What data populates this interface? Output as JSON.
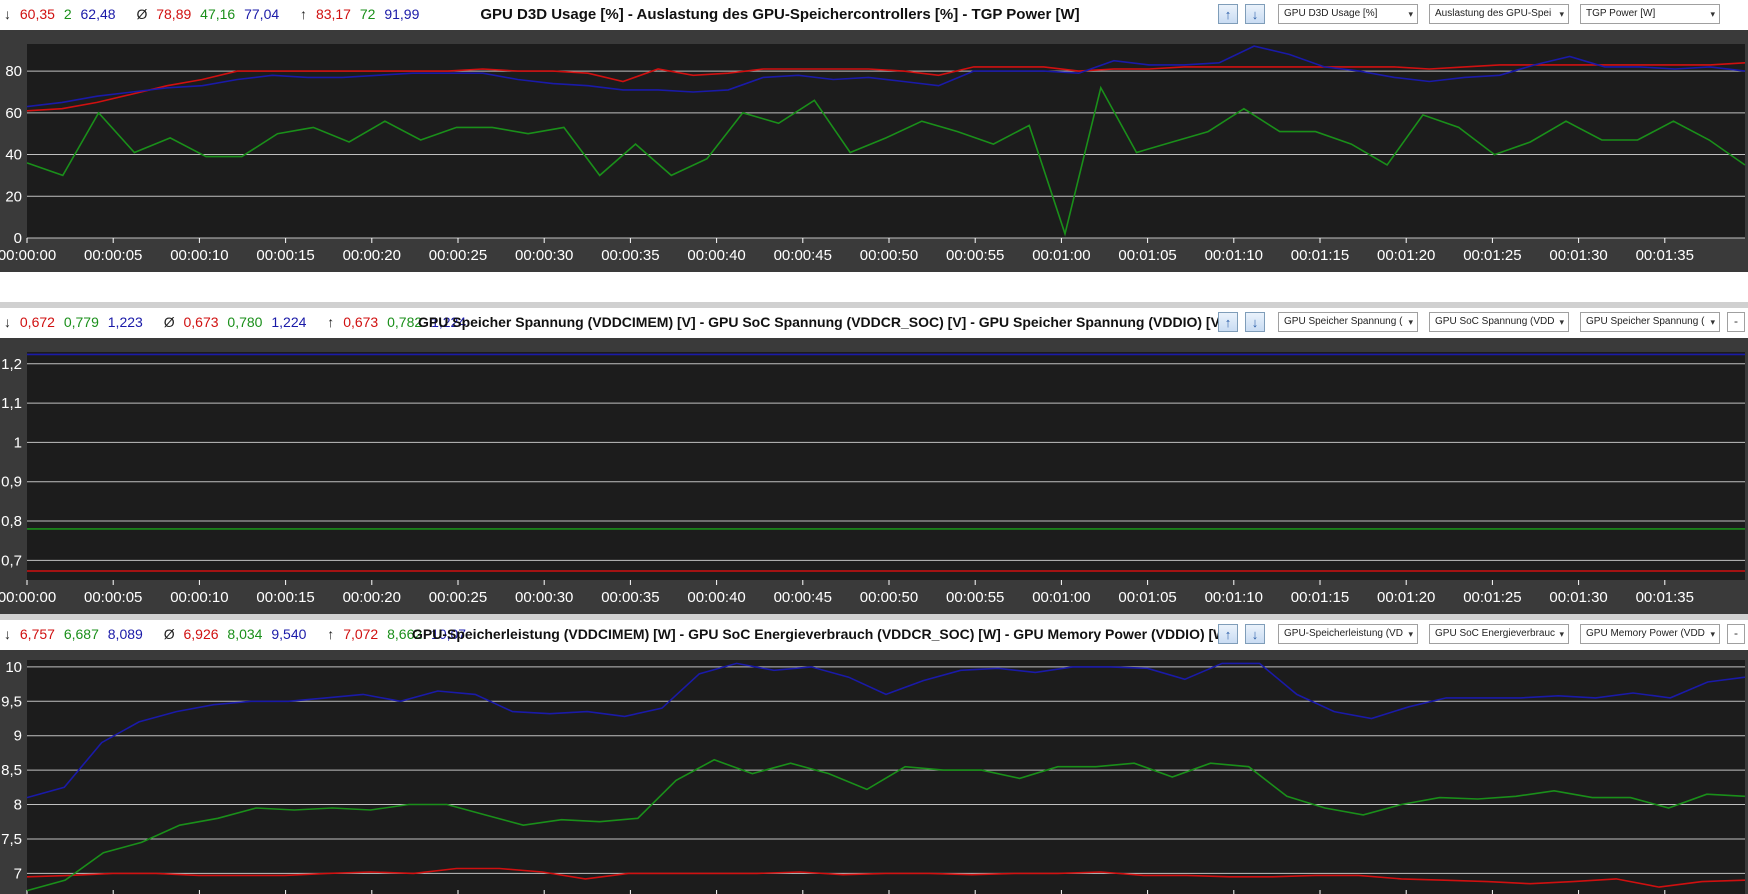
{
  "colors": {
    "red": "#d01010",
    "green": "#1a8f1a",
    "blue": "#1a1aa8",
    "bg": "#1c1c1c",
    "frame": "#3a3a3a",
    "grid": "#c0c0c0"
  },
  "panels": [
    {
      "title": "GPU D3D Usage [%]  -  Auslastung des GPU-Speichercontrollers [%]  -  TGP Power [W]",
      "stats": {
        "min": {
          "symbol": "↓",
          "values": [
            "60,35",
            "2",
            "62,48"
          ]
        },
        "avg": {
          "symbol": "Ø",
          "values": [
            "78,89",
            "47,16",
            "77,04"
          ]
        },
        "max": {
          "symbol": "↑",
          "values": [
            "83,17",
            "72",
            "91,99"
          ]
        }
      },
      "dropdowns": [
        "GPU D3D Usage [%]",
        "Auslastung des GPU-Spei",
        "TGP Power [W]"
      ],
      "has_minus_button": false
    },
    {
      "title": "GPU Speicher Spannung (VDDCIMEM) [V]  -  GPU SoC Spannung (VDDCR_SOC) [V]  -  GPU Speicher Spannung (VDDIO) [V]",
      "stats": {
        "min": {
          "symbol": "↓",
          "values": [
            "0,672",
            "0,779",
            "1,223"
          ]
        },
        "avg": {
          "symbol": "Ø",
          "values": [
            "0,673",
            "0,780",
            "1,224"
          ]
        },
        "max": {
          "symbol": "↑",
          "values": [
            "0,673",
            "0,782",
            "1,224"
          ]
        }
      },
      "dropdowns": [
        "GPU Speicher Spannung (",
        "GPU SoC Spannung (VDD",
        "GPU Speicher Spannung ("
      ],
      "has_minus_button": true
    },
    {
      "title": "GPU-Speicherleistung (VDDCIMEM) [W]  -  GPU SoC Energieverbrauch (VDDCR_SOC) [W]  -  GPU Memory Power (VDDIO) [W]",
      "stats": {
        "min": {
          "symbol": "↓",
          "values": [
            "6,757",
            "6,687",
            "8,089"
          ]
        },
        "avg": {
          "symbol": "Ø",
          "values": [
            "6,926",
            "8,034",
            "9,540"
          ]
        },
        "max": {
          "symbol": "↑",
          "values": [
            "7,072",
            "8,662",
            "10,07"
          ]
        }
      },
      "dropdowns": [
        "GPU-Speicherleistung (VD",
        "GPU SoC Energieverbrauc",
        "GPU Memory Power (VDD"
      ],
      "has_minus_button": true
    }
  ],
  "chart_data": [
    {
      "type": "line",
      "title": "GPU D3D Usage [%]  -  Auslastung des GPU-Speichercontrollers [%]  -  TGP Power [W]",
      "x_tick_labels": [
        "00:00:00",
        "00:00:05",
        "00:00:10",
        "00:00:15",
        "00:00:20",
        "00:00:25",
        "00:00:30",
        "00:00:35",
        "00:00:40",
        "00:00:45",
        "00:00:50",
        "00:00:55",
        "00:01:00",
        "00:01:05",
        "00:01:10",
        "00:01:15",
        "00:01:20",
        "00:01:25",
        "00:01:30",
        "00:01:35"
      ],
      "xlim": [
        0,
        100
      ],
      "ylim": [
        0,
        93
      ],
      "y_ticks": [
        0,
        20,
        40,
        60,
        80
      ],
      "y_tick_labels": [
        "0",
        "20",
        "40",
        "60",
        "80"
      ],
      "grid": true,
      "series": [
        {
          "name": "GPU D3D Usage [%]",
          "color": "#d01010",
          "values": [
            61,
            62,
            65,
            69,
            73,
            76,
            80,
            80,
            80,
            80,
            80,
            80,
            80,
            81,
            80,
            80,
            79,
            75,
            81,
            78,
            79,
            81,
            81,
            81,
            81,
            80,
            78,
            82,
            82,
            82,
            80,
            81,
            81,
            82,
            82,
            82,
            82,
            82,
            82,
            82,
            81,
            82,
            83,
            83,
            83,
            83,
            83,
            83,
            83,
            84
          ]
        },
        {
          "name": "Auslastung des GPU-Speichercontrollers [%]",
          "color": "#1a8f1a",
          "values": [
            36,
            30,
            60,
            41,
            48,
            39,
            39,
            50,
            53,
            46,
            56,
            47,
            53,
            53,
            50,
            53,
            30,
            45,
            30,
            38,
            60,
            55,
            66,
            41,
            48,
            56,
            51,
            45,
            54,
            2,
            72,
            41,
            46,
            51,
            62,
            51,
            51,
            45,
            35,
            59,
            53,
            40,
            46,
            56,
            47,
            47,
            56,
            47,
            35
          ]
        },
        {
          "name": "TGP Power [W]",
          "color": "#1a1aa8",
          "values": [
            63,
            65,
            68,
            70,
            72,
            73,
            76,
            78,
            77,
            77,
            78,
            79,
            79,
            79,
            76,
            74,
            73,
            71,
            71,
            70,
            71,
            77,
            78,
            76,
            77,
            75,
            73,
            80,
            80,
            80,
            79,
            85,
            83,
            83,
            84,
            92,
            88,
            82,
            80,
            77,
            75,
            77,
            78,
            83,
            87,
            82,
            82,
            81,
            82,
            80
          ]
        }
      ]
    },
    {
      "type": "line",
      "title": "GPU Speicher Spannung (VDDCIMEM) [V]  -  GPU SoC Spannung (VDDCR_SOC) [V]  -  GPU Speicher Spannung (VDDIO) [V]",
      "x_tick_labels": [
        "00:00:00",
        "00:00:05",
        "00:00:10",
        "00:00:15",
        "00:00:20",
        "00:00:25",
        "00:00:30",
        "00:00:35",
        "00:00:40",
        "00:00:45",
        "00:00:50",
        "00:00:55",
        "00:01:00",
        "00:01:05",
        "00:01:10",
        "00:01:15",
        "00:01:20",
        "00:01:25",
        "00:01:30",
        "00:01:35"
      ],
      "xlim": [
        0,
        100
      ],
      "ylim": [
        0.65,
        1.23
      ],
      "y_ticks": [
        0.7,
        0.8,
        0.9,
        1.0,
        1.1,
        1.2
      ],
      "y_tick_labels": [
        "0,7",
        "0,8",
        "0,9",
        "1",
        "1,1",
        "1,2"
      ],
      "grid": true,
      "series": [
        {
          "name": "GPU Speicher Spannung (VDDCIMEM) [V]",
          "color": "#d01010",
          "values": [
            0.673,
            0.673
          ]
        },
        {
          "name": "GPU SoC Spannung (VDDCR_SOC) [V]",
          "color": "#1a8f1a",
          "values": [
            0.78,
            0.78
          ]
        },
        {
          "name": "GPU Speicher Spannung (VDDIO) [V]",
          "color": "#1a1aa8",
          "values": [
            1.224,
            1.224
          ]
        }
      ]
    },
    {
      "type": "line",
      "title": "GPU-Speicherleistung (VDDCIMEM) [W]  -  GPU SoC Energieverbrauch (VDDCR_SOC) [W]  -  GPU Memory Power (VDDIO) [W]",
      "x_tick_labels": [],
      "xlim": [
        0,
        100
      ],
      "ylim": [
        6.7,
        10.1
      ],
      "y_ticks": [
        7,
        7.5,
        8,
        8.5,
        9,
        9.5,
        10
      ],
      "y_tick_labels": [
        "7",
        "7,5",
        "8",
        "8,5",
        "9",
        "9,5",
        "10"
      ],
      "grid": true,
      "series": [
        {
          "name": "GPU-Speicherleistung (VDDCIMEM) [W]",
          "color": "#d01010",
          "values": [
            6.95,
            6.97,
            7.0,
            7.0,
            6.97,
            6.97,
            6.97,
            7.0,
            7.02,
            7.0,
            7.07,
            7.07,
            7.02,
            6.92,
            7.0,
            7.0,
            7.0,
            7.0,
            7.02,
            6.98,
            7.0,
            7.0,
            6.98,
            7.0,
            7.0,
            7.02,
            6.97,
            6.97,
            6.95,
            6.95,
            6.97,
            6.97,
            6.92,
            6.9,
            6.88,
            6.85,
            6.88,
            6.92,
            6.8,
            6.88,
            6.9
          ]
        },
        {
          "name": "GPU SoC Energieverbrauch (VDDCR_SOC) [W]",
          "color": "#1a8f1a",
          "values": [
            6.75,
            6.9,
            7.3,
            7.45,
            7.7,
            7.8,
            7.95,
            7.92,
            7.95,
            7.92,
            8.0,
            8.0,
            7.85,
            7.7,
            7.78,
            7.75,
            7.8,
            8.35,
            8.65,
            8.45,
            8.6,
            8.45,
            8.22,
            8.55,
            8.5,
            8.5,
            8.38,
            8.55,
            8.55,
            8.6,
            8.4,
            8.6,
            8.55,
            8.12,
            7.95,
            7.85,
            8.0,
            8.1,
            8.08,
            8.12,
            8.2,
            8.1,
            8.1,
            7.95,
            8.15,
            8.12
          ]
        },
        {
          "name": "GPU Memory Power (VDDIO) [W]",
          "color": "#1a1aa8",
          "values": [
            8.1,
            8.25,
            8.9,
            9.2,
            9.35,
            9.45,
            9.5,
            9.5,
            9.55,
            9.6,
            9.5,
            9.65,
            9.6,
            9.35,
            9.32,
            9.35,
            9.28,
            9.4,
            9.9,
            10.05,
            9.95,
            10.0,
            9.85,
            9.6,
            9.8,
            9.95,
            9.98,
            9.92,
            10.0,
            10.0,
            9.98,
            9.82,
            10.05,
            10.05,
            9.6,
            9.35,
            9.25,
            9.42,
            9.55,
            9.55,
            9.55,
            9.58,
            9.55,
            9.62,
            9.55,
            9.78,
            9.85
          ]
        }
      ]
    }
  ]
}
